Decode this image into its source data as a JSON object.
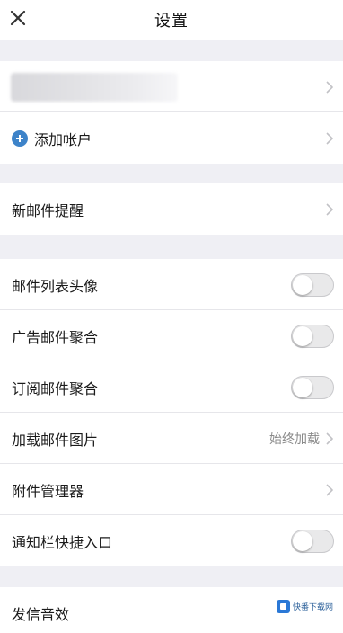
{
  "header": {
    "title": "设置"
  },
  "account": {
    "add_account_label": "添加帐户"
  },
  "notify": {
    "new_mail_alert_label": "新邮件提醒"
  },
  "settings": {
    "items": [
      {
        "label": "邮件列表头像",
        "control": "toggle",
        "on": false
      },
      {
        "label": "广告邮件聚合",
        "control": "toggle",
        "on": false
      },
      {
        "label": "订阅邮件聚合",
        "control": "toggle",
        "on": false
      },
      {
        "label": "加载邮件图片",
        "control": "value",
        "value": "始终加载"
      },
      {
        "label": "附件管理器",
        "control": "chevron"
      },
      {
        "label": "通知栏快捷入口",
        "control": "toggle",
        "on": false
      }
    ]
  },
  "sound": {
    "send_sound_label": "发信音效"
  },
  "watermark": {
    "text": "快番下载网"
  },
  "colors": {
    "accent_blue": "#3d83c9",
    "background": "#efeff4",
    "row_background": "#ffffff",
    "toggle_off": "#e9e9ea"
  }
}
